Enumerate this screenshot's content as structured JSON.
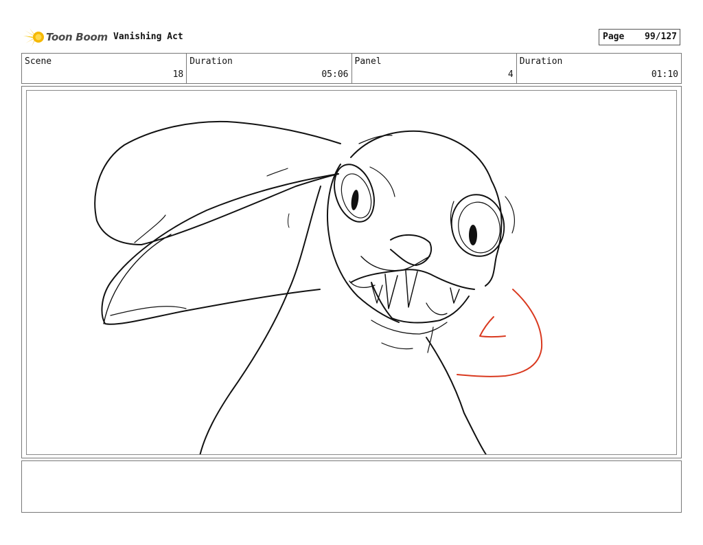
{
  "header": {
    "brand": "Toon Boom",
    "project_title": "Vanishing Act",
    "page_label": "Page",
    "page_value": "99/127"
  },
  "info": {
    "scene_label": "Scene",
    "scene_value": "18",
    "scene_duration_label": "Duration",
    "scene_duration_value": "05:06",
    "panel_label": "Panel",
    "panel_value": "4",
    "panel_duration_label": "Duration",
    "panel_duration_value": "01:10"
  },
  "colors": {
    "sketch_line": "#111111",
    "annotation_red": "#d9391f",
    "logo_yellow": "#f5b800"
  }
}
